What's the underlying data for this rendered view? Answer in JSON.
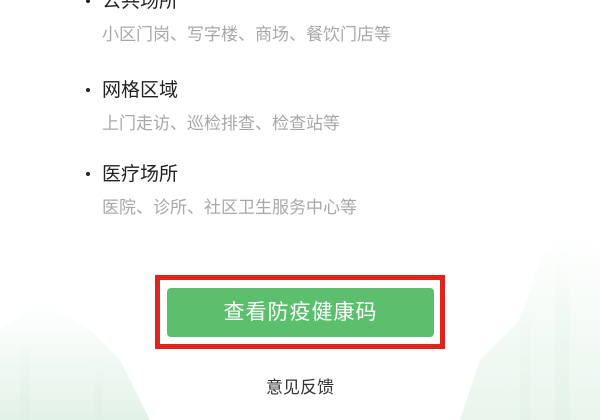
{
  "scenes": [
    {
      "title": "公共场所",
      "desc": "小区门岗、写字楼、商场、餐饮门店等"
    },
    {
      "title": "网格区域",
      "desc": "上门走访、巡检排查、检查站等"
    },
    {
      "title": "医疗场所",
      "desc": "医院、诊所、社区卫生服务中心等"
    }
  ],
  "actions": {
    "view_health_code": "查看防疫健康码",
    "feedback": "意见反馈"
  },
  "colors": {
    "button": "#5bbf6e",
    "highlight_border": "#e4231d",
    "title_text": "#222222",
    "desc_text": "#a8a8a8"
  }
}
